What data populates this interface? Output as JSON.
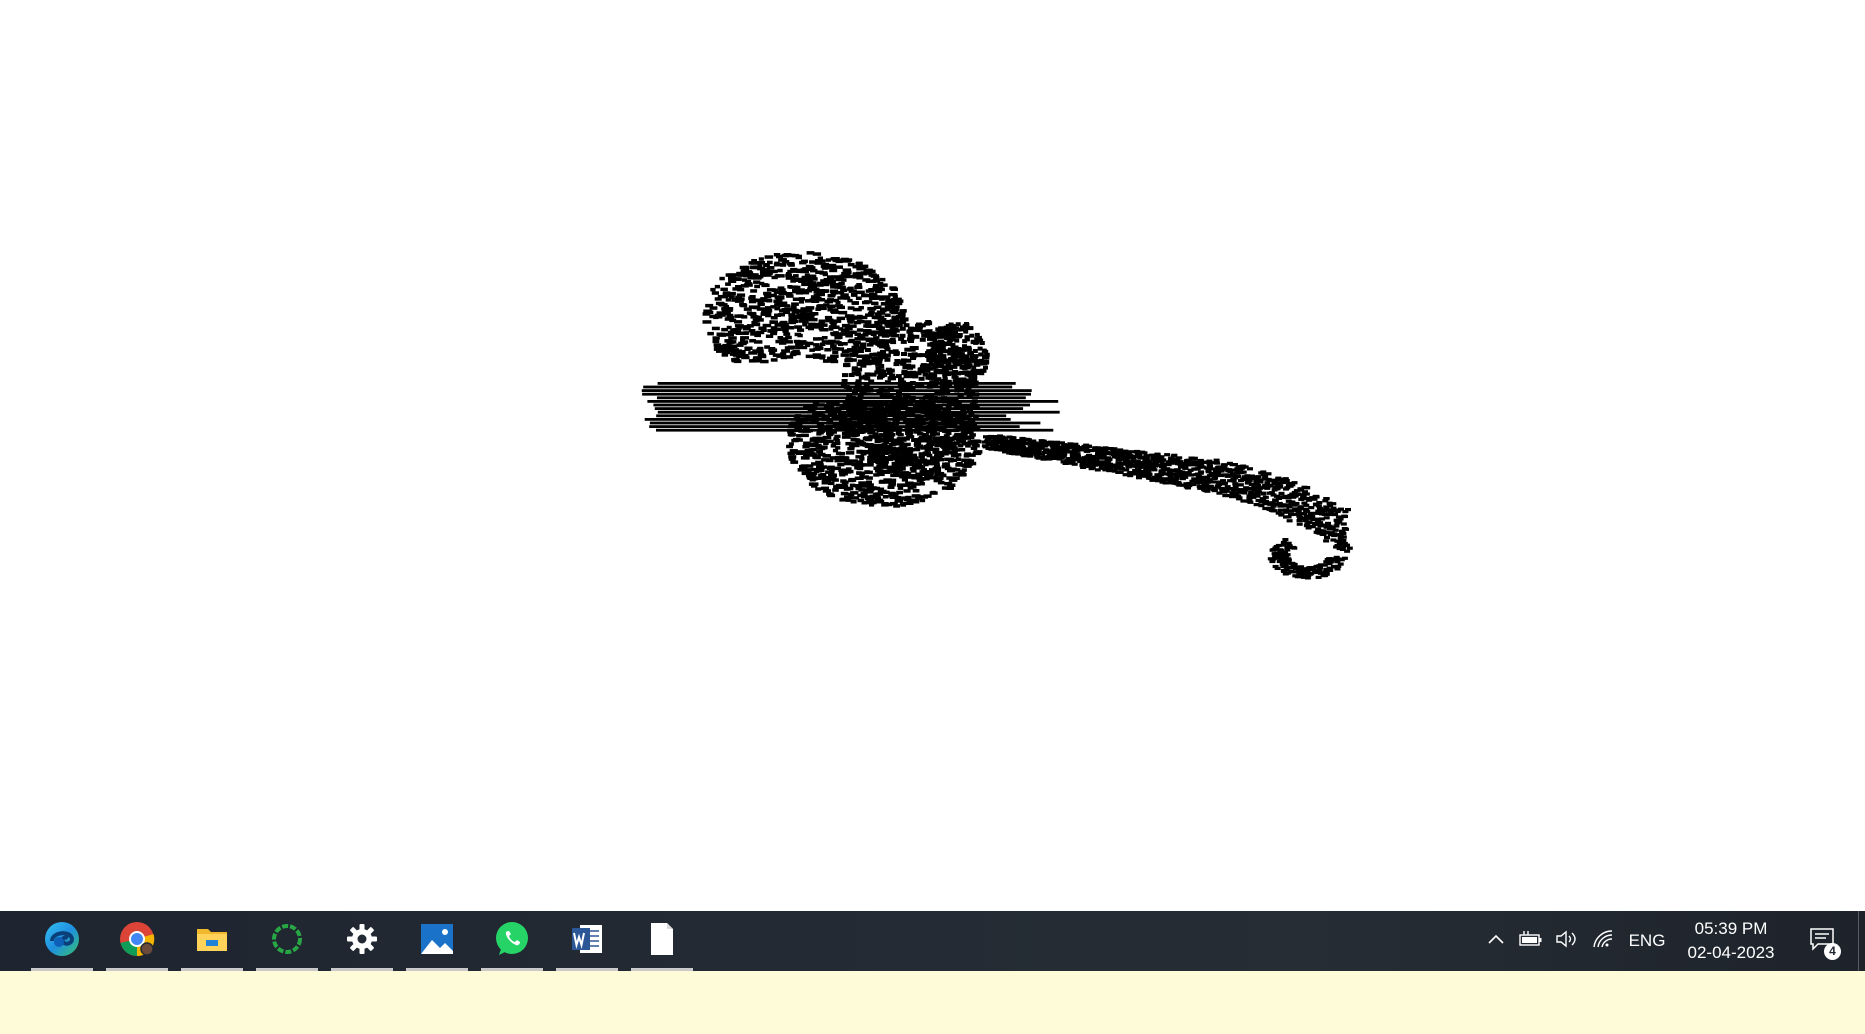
{
  "canvas": {
    "description_icon": "3d-point-cloud-render",
    "point_color": "#000000",
    "background": "#ffffff"
  },
  "taskbar": {
    "apps": [
      {
        "name": "Microsoft Edge",
        "icon": "edge-icon",
        "running": true
      },
      {
        "name": "Google Chrome",
        "icon": "chrome-icon",
        "running": true
      },
      {
        "name": "File Explorer",
        "icon": "folder-icon",
        "running": true
      },
      {
        "name": "Loading",
        "icon": "ring-spinner-icon",
        "running": true
      },
      {
        "name": "Settings",
        "icon": "gear-icon",
        "running": true
      },
      {
        "name": "Photos",
        "icon": "photos-icon",
        "running": true
      },
      {
        "name": "WhatsApp",
        "icon": "whatsapp-icon",
        "running": true
      },
      {
        "name": "Microsoft Word",
        "icon": "word-icon",
        "running": true
      },
      {
        "name": "Document",
        "icon": "blank-file-icon",
        "running": true
      }
    ],
    "tray": {
      "language": "ENG",
      "time": "05:39 PM",
      "date": "02-04-2023",
      "notification_count": "4"
    }
  },
  "colors": {
    "taskbar": "#232a33",
    "below_area": "#fefbd8"
  }
}
